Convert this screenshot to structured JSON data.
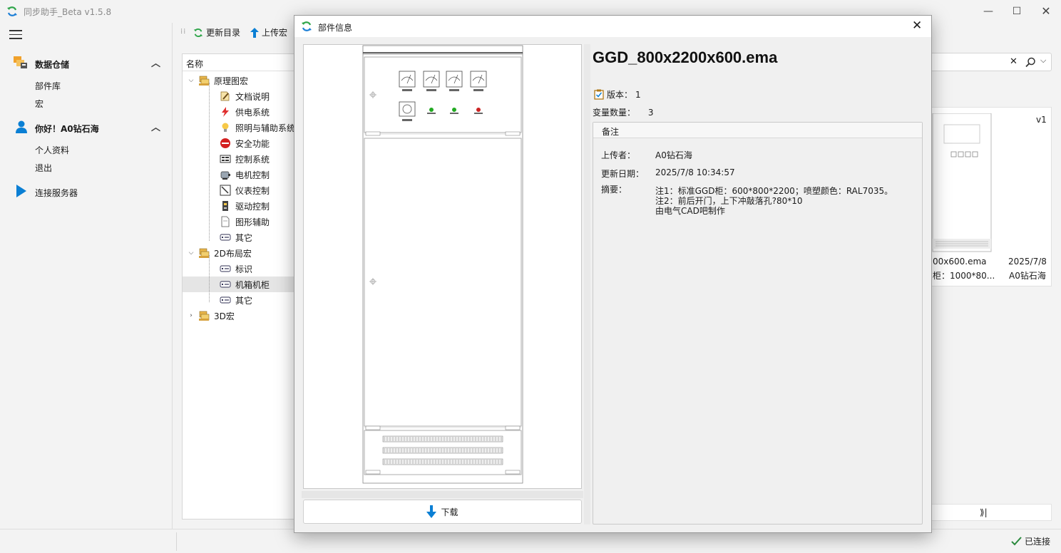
{
  "window": {
    "title": "同步助手_Beta v1.5.8",
    "accent": "#0a7fd4"
  },
  "sidebar": {
    "sections": [
      {
        "label": "数据仓储",
        "items": [
          "部件库",
          "宏"
        ]
      },
      {
        "label": "你好！A0钻石海",
        "items": [
          "个人资料",
          "退出"
        ]
      }
    ],
    "connect_label": "连接服务器"
  },
  "toolbar": {
    "refresh_label": "更新目录",
    "upload_label": "上传宏"
  },
  "tree": {
    "header": "名称",
    "nodes": [
      {
        "label": "原理图宏",
        "level": 0,
        "icon": "folder-stack-icon"
      },
      {
        "label": "文档说明",
        "level": 1,
        "icon": "document-pen-icon"
      },
      {
        "label": "供电系统",
        "level": 1,
        "icon": "lightning-icon"
      },
      {
        "label": "照明与辅助系统",
        "level": 1,
        "icon": "bulb-icon"
      },
      {
        "label": "安全功能",
        "level": 1,
        "icon": "stop-sign-icon"
      },
      {
        "label": "控制系统",
        "level": 1,
        "icon": "control-panel-icon"
      },
      {
        "label": "电机控制",
        "level": 1,
        "icon": "motor-icon"
      },
      {
        "label": "仪表控制",
        "level": 1,
        "icon": "gauge-icon"
      },
      {
        "label": "驱动控制",
        "level": 1,
        "icon": "drive-icon"
      },
      {
        "label": "图形辅助",
        "level": 1,
        "icon": "page-icon"
      },
      {
        "label": "其它",
        "level": 1,
        "icon": "tag-icon"
      },
      {
        "label": "2D布局宏",
        "level": 0,
        "icon": "folder-stack-icon"
      },
      {
        "label": "标识",
        "level": 1,
        "icon": "tag-icon"
      },
      {
        "label": "机箱机柜",
        "level": 1,
        "icon": "tag-icon"
      },
      {
        "label": "其它",
        "level": 1,
        "icon": "tag-icon"
      },
      {
        "label": "3D宏",
        "level": 0,
        "icon": "folder-stack-icon"
      }
    ]
  },
  "card": {
    "version_tag": "v1",
    "file_name": "00x600.ema",
    "date": "2025/7/8",
    "desc": "柜：1000*80...",
    "author": "A0钻石海"
  },
  "pager": {
    "last_label": "⟫|"
  },
  "status": {
    "connected_label": "已连接"
  },
  "dialog": {
    "title": "部件信息",
    "file_name": "GGD_800x2200x600.ema",
    "version_label": "版本：",
    "version_value": "1",
    "variants_label": "变量数量：",
    "variants_value": "3",
    "notes_header": "备注",
    "uploader_label": "上传者：",
    "uploader_value": "A0钻石海",
    "updated_label": "更新日期：",
    "updated_value": "2025/7/8 10:34:57",
    "summary_label": "摘要：",
    "summary_lines": [
      "注1：标准GGD柜：600*800*2200；喷塑颜色：RAL7035。",
      "注2：前后开门，上下冲敲落孔?80*10",
      "由电气CAD吧制作"
    ],
    "download_label": "下载"
  }
}
